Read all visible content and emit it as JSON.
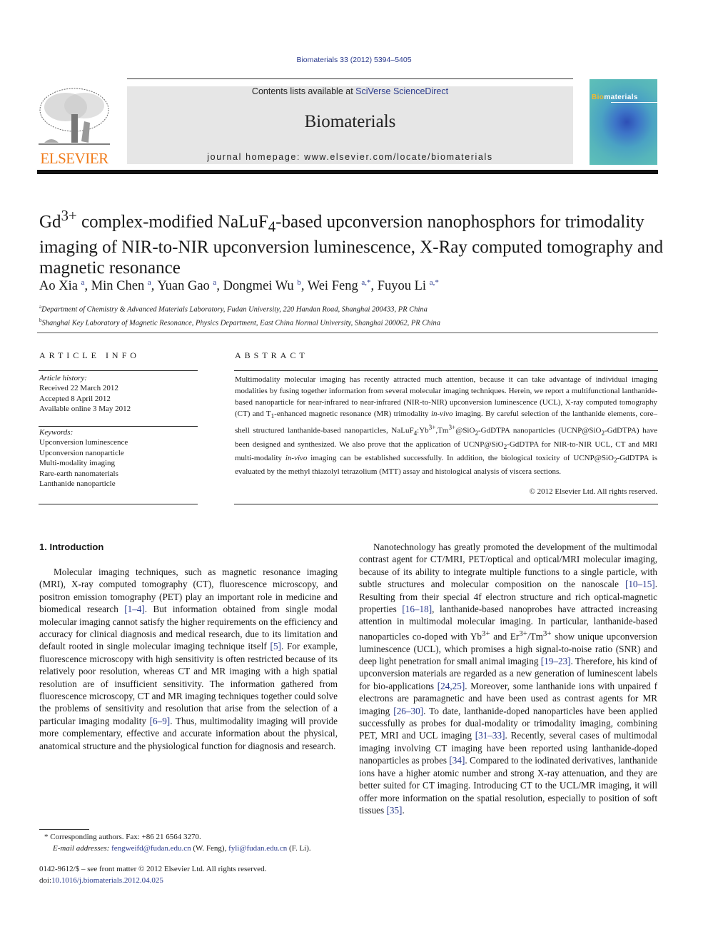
{
  "header": {
    "journal_ref": "Biomaterials 33 (2012) 5394–5405",
    "contents_prefix": "Contents lists available at ",
    "contents_link": "SciVerse ScienceDirect",
    "journal_name": "Biomaterials",
    "homepage": "journal homepage: www.elsevier.com/locate/biomaterials",
    "publisher_logo_text": "ELSEVIER",
    "cover_title_prefix": "Bio",
    "cover_title_rest": "materials",
    "colors": {
      "link": "#2a3a8c",
      "elsevier_orange": "#f07b1a",
      "masthead_bg": "#e6e6e6"
    }
  },
  "article": {
    "title_parts": {
      "p1": "Gd",
      "sup1": "3+",
      "p2": " complex-modified NaLuF",
      "sub1": "4",
      "p3": "-based upconversion nanophosphors for trimodality imaging of NIR-to-NIR upconversion luminescence, X-Ray computed tomography and magnetic resonance"
    },
    "authors": [
      {
        "name": "Ao Xia",
        "aff": "a"
      },
      {
        "name": "Min Chen",
        "aff": "a"
      },
      {
        "name": "Yuan Gao",
        "aff": "a"
      },
      {
        "name": "Dongmei Wu",
        "aff": "b"
      },
      {
        "name": "Wei Feng",
        "aff": "a,*"
      },
      {
        "name": "Fuyou Li",
        "aff": "a,*"
      }
    ],
    "affiliations": [
      {
        "mark": "a",
        "text": "Department of Chemistry & Advanced Materials Laboratory, Fudan University, 220 Handan Road, Shanghai 200433, PR China"
      },
      {
        "mark": "b",
        "text": "Shanghai Key Laboratory of Magnetic Resonance, Physics Department, East China Normal University, Shanghai 200062, PR China"
      }
    ]
  },
  "article_info": {
    "heading": "ARTICLE INFO",
    "history_label": "Article history:",
    "history": [
      "Received 22 March 2012",
      "Accepted 8 April 2012",
      "Available online 3 May 2012"
    ],
    "keywords_label": "Keywords:",
    "keywords": [
      "Upconversion luminescence",
      "Upconversion nanoparticle",
      "Multi-modality imaging",
      "Rare-earth nanomaterials",
      "Lanthanide nanoparticle"
    ]
  },
  "abstract": {
    "heading": "ABSTRACT",
    "s1": "Multimodality molecular imaging has recently attracted much attention, because it can take advantage of individual imaging modalities by fusing together information from several molecular imaging techniques. Herein, we report a multifunctional lanthanide-based nanoparticle for near-infrared to near-infrared (NIR-to-NIR) upconversion luminescence (UCL), X-ray computed tomography (CT) and T",
    "s1_sub": "1",
    "s2": "-enhanced magnetic resonance (MR) trimodality ",
    "s2_it": "in-vivo",
    "s3": " imaging. By careful selection of the lanthanide elements, core–shell structured lanthanide-based nanoparticles, NaLuF",
    "s3_sub": "4",
    "s4": ":Yb",
    "s4_sup": "3+",
    "s5": ",Tm",
    "s5_sup": "3+",
    "s6": "@SiO",
    "s6_sub": "2",
    "s7": "-GdDTPA nanoparticles (UCNP@SiO",
    "s7_sub": "2",
    "s8": "-GdDTPA) have been designed and synthesized. We also prove that the application of UCNP@SiO",
    "s8_sub": "2",
    "s9": "-GdDTPA for NIR-to-NIR UCL, CT and MRI multi-modality ",
    "s9_it": "in-vivo",
    "s10": " imaging can be established successfully. In addition, the biological toxicity of UCNP@SiO",
    "s10_sub": "2",
    "s11": "-GdDTPA is evaluated by the methyl thiazolyl tetrazolium (MTT) assay and histological analysis of viscera sections.",
    "copyright": "© 2012 Elsevier Ltd. All rights reserved."
  },
  "intro": {
    "heading": "1.  Introduction",
    "left_p": {
      "t1": "Molecular imaging techniques, such as magnetic resonance imaging (MRI), X-ray computed tomography (CT), fluorescence microscopy, and positron emission tomography (PET) play an important role in medicine and biomedical research ",
      "r1": "[1–4]",
      "t2": ". But information obtained from single modal molecular imaging cannot satisfy the higher requirements on the efficiency and accuracy for clinical diagnosis and medical research, due to its limitation and default rooted in single molecular imaging technique itself ",
      "r2": "[5]",
      "t3": ". For example, fluorescence microscopy with high sensitivity is often restricted because of its relatively poor resolution, whereas CT and MR imaging with a high spatial resolution are of insufficient sensitivity. The information gathered from fluorescence microscopy, CT and MR imaging techniques together could solve the problems of sensitivity and resolution that arise from the selection of a particular imaging modality ",
      "r3": "[6–9]",
      "t4": ". Thus, multimodality imaging will provide more complementary, effective and accurate information about the physical, anatomical structure and the physiological function for diagnosis and research."
    },
    "right_p": {
      "t1": "Nanotechnology has greatly promoted the development of the multimodal contrast agent for CT/MRI, PET/optical and optical/MRI molecular imaging, because of its ability to integrate multiple functions to a single particle, with subtle structures and molecular composition on the nanoscale ",
      "r1": "[10–15]",
      "t2": ". Resulting from their special 4f electron structure and rich optical-magnetic properties ",
      "r2": "[16–18]",
      "t3": ", lanthanide-based nanoprobes have attracted increasing attention in multimodal molecular imaging. In particular, lanthanide-based nanoparticles co-doped with Yb",
      "sup1": "3+",
      "t4": " and Er",
      "sup2": "3+",
      "t5": "/Tm",
      "sup3": "3+",
      "t6": " show unique upconversion luminescence (UCL), which promises a high signal-to-noise ratio (SNR) and deep light penetration for small animal imaging ",
      "r3": "[19–23]",
      "t7": ". Therefore, his kind of upconversion materials are regarded as a new generation of luminescent labels for bio-applications ",
      "r4": "[24,25]",
      "t8": ". Moreover, some lanthanide ions with unpaired f electrons are paramagnetic and have been used as contrast agents for MR imaging ",
      "r5": "[26–30]",
      "t9": ". To date, lanthanide-doped nanoparticles have been applied successfully as probes for dual-modality or trimodality imaging, combining PET, MRI and UCL imaging ",
      "r6": "[31–33]",
      "t10": ". Recently, several cases of multimodal imaging involving CT imaging have been reported using lanthanide-doped nanoparticles as probes ",
      "r7": "[34]",
      "t11": ". Compared to the iodinated derivatives, lanthanide ions have a higher atomic number and strong X-ray attenuation, and they are better suited for CT imaging. Introducing CT to the UCL/MR imaging, it will offer more information on the spatial resolution, especially to position of soft tissues ",
      "r8": "[35]",
      "t12": "."
    }
  },
  "footnotes": {
    "corresponding": "*  Corresponding authors. Fax: +86 21 6564 3270.",
    "email_label": "E-mail addresses: ",
    "email1": "fengweifd@fudan.edu.cn",
    "email1_who": " (W. Feng), ",
    "email2": "fyli@fudan.edu.cn",
    "email2_who": " (F. Li).",
    "front_matter": "0142-9612/$ – see front matter © 2012 Elsevier Ltd. All rights reserved.",
    "doi_label": "doi:",
    "doi": "10.1016/j.biomaterials.2012.04.025"
  }
}
